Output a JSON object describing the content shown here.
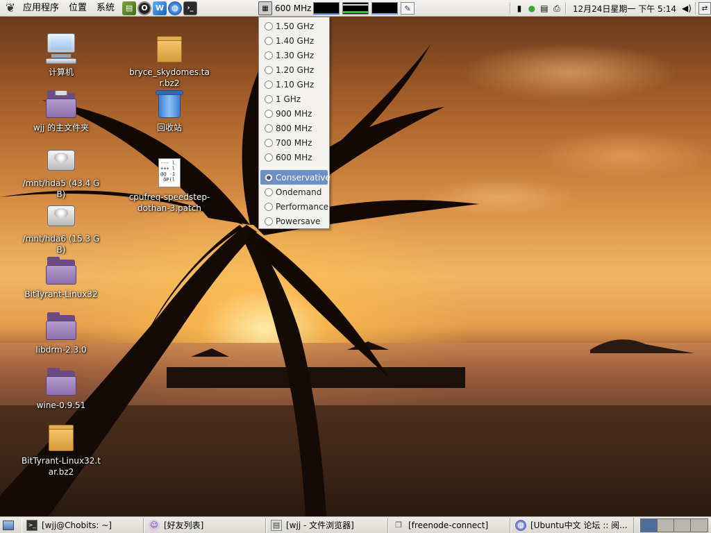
{
  "top_panel": {
    "menus": [
      "应用程序",
      "位置",
      "系统"
    ],
    "launchers": [
      {
        "icon": "book-icon",
        "glyph": "▤"
      },
      {
        "icon": "opera-icon",
        "glyph": "O"
      },
      {
        "icon": "wiki-icon",
        "glyph": "W"
      },
      {
        "icon": "firefox-icon",
        "glyph": "◍"
      },
      {
        "icon": "terminal-icon",
        "glyph": "›_"
      }
    ],
    "cpu_frequency": "600 MHz",
    "clock": "12月24日星期一 下午 5:14"
  },
  "freq_menu": {
    "frequencies": [
      "1.50 GHz",
      "1.40 GHz",
      "1.30 GHz",
      "1.20 GHz",
      "1.10 GHz",
      "1 GHz",
      "900 MHz",
      "800 MHz",
      "700 MHz",
      "600 MHz"
    ],
    "governors": [
      "Conservative",
      "Ondemand",
      "Performance",
      "Powersave"
    ],
    "selected_governor": "Conservative"
  },
  "desktop_icons": {
    "computer": "计算机",
    "home": "wjj 的主文件夹",
    "hda5": "/mnt/hda5 (43.4 GB)",
    "hda6": "/mnt/hda6 (15.3 GB)",
    "bittyrant_dir": "BitTyrant-Linux32",
    "libdrm": "libdrm-2.3.0",
    "wine": "wine-0.9.51",
    "bittyrant_archive": "BitTyrant-Linux32.tar.bz2",
    "bryce": "bryce_skydomes.tar.bz2",
    "trash": "回收站",
    "patch": "cpufreq-speedstep-dothan-3.patch"
  },
  "taskbar": {
    "tasks": [
      "[wjj@Chobits: ~]",
      "[好友列表]",
      "[wjj - 文件浏览器]",
      "[freenode-connect]",
      "[Ubuntu中文 论坛 :: 阅..."
    ]
  },
  "colors": {
    "menu_highlight": "#6b8fc6",
    "panel_bg": "#e3e1dc",
    "active_workspace": "#4d6d9a"
  }
}
